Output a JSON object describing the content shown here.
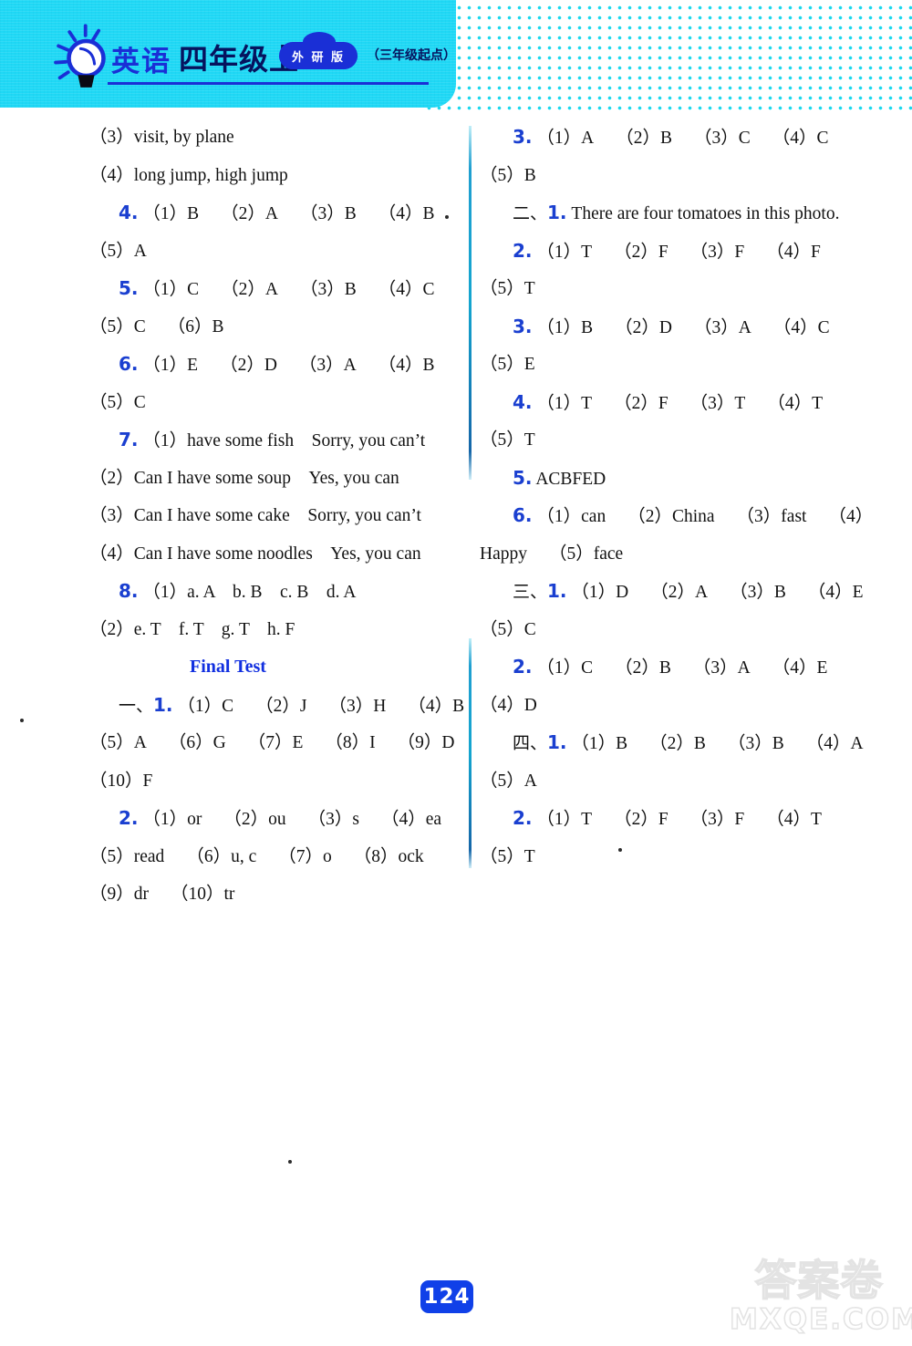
{
  "header": {
    "subject": "英语",
    "grade": "四年级上",
    "edition_badge": "外 研 版",
    "starting_point": "（三年级起点）",
    "bulb_icon": "lightbulb-icon"
  },
  "left_column": [
    {
      "style": "flush",
      "parts": [
        {
          "t": "（3）visit, by plane"
        }
      ]
    },
    {
      "style": "flush",
      "parts": [
        {
          "t": "（4）long jump, high jump"
        }
      ]
    },
    {
      "style": "ind",
      "parts": [
        {
          "n": "4."
        },
        {
          "t": "（1）B"
        },
        {
          "t": "（2）A"
        },
        {
          "t": "（3）B"
        },
        {
          "t": "（4）B"
        }
      ]
    },
    {
      "style": "flush",
      "parts": [
        {
          "t": "（5）A"
        }
      ]
    },
    {
      "style": "ind",
      "parts": [
        {
          "n": "5."
        },
        {
          "t": "（1）C"
        },
        {
          "t": "（2）A"
        },
        {
          "t": "（3）B"
        },
        {
          "t": "（4）C"
        }
      ]
    },
    {
      "style": "flush",
      "parts": [
        {
          "t": "（5）C"
        },
        {
          "t": "（6）B"
        }
      ]
    },
    {
      "style": "ind",
      "parts": [
        {
          "n": "6."
        },
        {
          "t": "（1）E"
        },
        {
          "t": "（2）D"
        },
        {
          "t": "（3）A"
        },
        {
          "t": "（4）B"
        }
      ]
    },
    {
      "style": "flush",
      "parts": [
        {
          "t": "（5）C"
        }
      ]
    },
    {
      "style": "ind",
      "parts": [
        {
          "n": "7."
        },
        {
          "t": "（1）have some fish　Sorry, you can’t"
        }
      ]
    },
    {
      "style": "flush",
      "parts": [
        {
          "t": "（2）Can I have some soup　Yes, you can"
        }
      ]
    },
    {
      "style": "flush",
      "parts": [
        {
          "t": "（3）Can I have some cake　Sorry, you can’t"
        }
      ]
    },
    {
      "style": "flush",
      "parts": [
        {
          "t": "（4）Can I have some noodles　Yes, you can"
        }
      ]
    },
    {
      "style": "ind",
      "parts": [
        {
          "n": "8."
        },
        {
          "t": "（1）a. A　b. B　c. B　d. A"
        }
      ]
    },
    {
      "style": "flush",
      "parts": [
        {
          "t": "（2）e. T　f. T　g. T　h. F"
        }
      ]
    },
    {
      "style": "heading",
      "parts": [
        {
          "t": "Final Test"
        }
      ]
    },
    {
      "style": "ind",
      "parts": [
        {
          "c": "一、"
        },
        {
          "n": "1."
        },
        {
          "t": "（1）C"
        },
        {
          "t": "（2）J"
        },
        {
          "t": "（3）H"
        },
        {
          "t": "（4）B"
        }
      ]
    },
    {
      "style": "flush",
      "parts": [
        {
          "t": "（5）A"
        },
        {
          "t": "（6）G"
        },
        {
          "t": "（7）E"
        },
        {
          "t": "（8）I"
        },
        {
          "t": "（9）D"
        }
      ]
    },
    {
      "style": "flush",
      "parts": [
        {
          "t": "（10）F"
        }
      ]
    },
    {
      "style": "ind",
      "parts": [
        {
          "n": "2."
        },
        {
          "t": "（1）or"
        },
        {
          "t": "（2）ou"
        },
        {
          "t": "（3）s"
        },
        {
          "t": "（4）ea"
        }
      ]
    },
    {
      "style": "flush",
      "parts": [
        {
          "t": "（5）read"
        },
        {
          "t": "（6）u, c"
        },
        {
          "t": "（7）o"
        },
        {
          "t": "（8）ock"
        }
      ]
    },
    {
      "style": "flush",
      "parts": [
        {
          "t": "（9）dr"
        },
        {
          "t": "（10）tr"
        }
      ]
    }
  ],
  "right_column": [
    {
      "style": "ind",
      "parts": [
        {
          "n": "3."
        },
        {
          "t": "（1）A"
        },
        {
          "t": "（2）B"
        },
        {
          "t": "（3）C"
        },
        {
          "t": "（4）C"
        }
      ]
    },
    {
      "style": "flush",
      "parts": [
        {
          "t": "（5）B"
        }
      ]
    },
    {
      "style": "ind",
      "parts": [
        {
          "c": "二、"
        },
        {
          "n": "1."
        },
        {
          "t": "There are four tomatoes in this photo."
        }
      ]
    },
    {
      "style": "ind",
      "parts": [
        {
          "n": "2."
        },
        {
          "t": "（1）T"
        },
        {
          "t": "（2）F"
        },
        {
          "t": "（3）F"
        },
        {
          "t": "（4）F"
        }
      ]
    },
    {
      "style": "flush",
      "parts": [
        {
          "t": "（5）T"
        }
      ]
    },
    {
      "style": "ind",
      "parts": [
        {
          "n": "3."
        },
        {
          "t": "（1）B"
        },
        {
          "t": "（2）D"
        },
        {
          "t": "（3）A"
        },
        {
          "t": "（4）C"
        }
      ]
    },
    {
      "style": "flush",
      "parts": [
        {
          "t": "（5）E"
        }
      ]
    },
    {
      "style": "ind",
      "parts": [
        {
          "n": "4."
        },
        {
          "t": "（1）T"
        },
        {
          "t": "（2）F"
        },
        {
          "t": "（3）T"
        },
        {
          "t": "（4）T"
        }
      ]
    },
    {
      "style": "flush",
      "parts": [
        {
          "t": "（5）T"
        }
      ]
    },
    {
      "style": "ind",
      "parts": [
        {
          "n": "5."
        },
        {
          "t": "ACBFED"
        }
      ]
    },
    {
      "style": "ind",
      "parts": [
        {
          "n": "6."
        },
        {
          "t": "（1）can"
        },
        {
          "t": "（2）China"
        },
        {
          "t": "（3）fast"
        },
        {
          "t": "（4）"
        }
      ]
    },
    {
      "style": "flush",
      "parts": [
        {
          "t": "Happy"
        },
        {
          "t": "（5）face"
        }
      ]
    },
    {
      "style": "ind",
      "parts": [
        {
          "c": "三、"
        },
        {
          "n": "1."
        },
        {
          "t": "（1）D"
        },
        {
          "t": "（2）A"
        },
        {
          "t": "（3）B"
        },
        {
          "t": "（4）E"
        }
      ]
    },
    {
      "style": "flush",
      "parts": [
        {
          "t": "（5）C"
        }
      ]
    },
    {
      "style": "ind",
      "parts": [
        {
          "n": "2."
        },
        {
          "t": "（1）C"
        },
        {
          "t": "（2）B"
        },
        {
          "t": "（3）A"
        },
        {
          "t": "（4）E"
        }
      ]
    },
    {
      "style": "flush",
      "parts": [
        {
          "t": "（4）D"
        }
      ]
    },
    {
      "style": "ind",
      "parts": [
        {
          "c": "四、"
        },
        {
          "n": "1."
        },
        {
          "t": "（1）B"
        },
        {
          "t": "（2）B"
        },
        {
          "t": "（3）B"
        },
        {
          "t": "（4）A"
        }
      ]
    },
    {
      "style": "flush",
      "parts": [
        {
          "t": "（5）A"
        }
      ]
    },
    {
      "style": "ind",
      "parts": [
        {
          "n": "2."
        },
        {
          "t": "（1）T"
        },
        {
          "t": "（2）F"
        },
        {
          "t": "（3）F"
        },
        {
          "t": "（4）T"
        }
      ]
    },
    {
      "style": "flush",
      "parts": [
        {
          "t": "（5）T"
        }
      ]
    }
  ],
  "footer": {
    "page_number": "124",
    "watermark_cn": "答案卷",
    "watermark_en": "MXQE.COM"
  },
  "colors": {
    "accent_blue": "#1a3fd0",
    "header_cyan": "#1fd8f5",
    "header_deep_blue": "#1a2fd6",
    "divider_teal": "#14a5cf"
  }
}
